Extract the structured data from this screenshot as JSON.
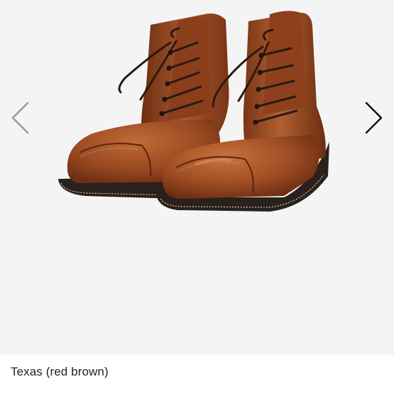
{
  "gallery": {
    "prev_icon": "chevron-left-icon",
    "next_icon": "chevron-right-icon",
    "image_subject": "boots-photo"
  },
  "caption": {
    "text": "Texas (red brown)"
  },
  "colors": {
    "background": "#f4f4f4",
    "leather": "#9a4a22",
    "leather_dark": "#6e2f12",
    "sole": "#2b211c",
    "laces": "#2a1a14",
    "prev_arrow": "#9a9a9a",
    "next_arrow": "#111111"
  }
}
